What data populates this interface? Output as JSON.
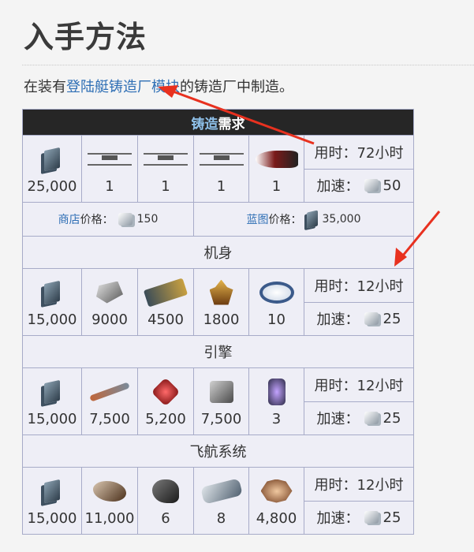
{
  "page_title": "入手方法",
  "intro": {
    "prefix": "在装有",
    "link": "登陆艇铸造厂模块",
    "suffix": "的铸造厂中制造。"
  },
  "table": {
    "header_link": "铸造",
    "header_rest": "需求",
    "time_label": "用时：",
    "rush_label": "加速：",
    "main": {
      "resources": [
        {
          "icon": "credits-icon",
          "qty": "25,000"
        },
        {
          "icon": "blueprint-part-icon",
          "qty": "1"
        },
        {
          "icon": "blueprint-part-icon",
          "qty": "1"
        },
        {
          "icon": "blueprint-part-icon",
          "qty": "1"
        },
        {
          "icon": "ship-part-icon",
          "qty": "1"
        }
      ],
      "time": "72小时",
      "rush": "50"
    },
    "market": {
      "link": "商店",
      "label": "价格：",
      "value": "150"
    },
    "blueprint": {
      "link": "蓝图",
      "label": "价格：",
      "value": "35,000"
    },
    "sections": [
      {
        "name": "机身",
        "resources": [
          {
            "icon": "credits-icon",
            "qty": "15,000"
          },
          {
            "icon": "polymer-icon",
            "qty": "9000"
          },
          {
            "icon": "plastids-icon",
            "qty": "4500"
          },
          {
            "icon": "crystal-icon",
            "qty": "1800"
          },
          {
            "icon": "alloy-ring-icon",
            "qty": "10"
          }
        ],
        "time": "12小时",
        "rush": "25"
      },
      {
        "name": "引擎",
        "resources": [
          {
            "icon": "credits-icon",
            "qty": "15,000"
          },
          {
            "icon": "rod-icon",
            "qty": "7,500"
          },
          {
            "icon": "gem-icon",
            "qty": "5,200"
          },
          {
            "icon": "block-icon",
            "qty": "7,500"
          },
          {
            "icon": "cell-icon",
            "qty": "3"
          }
        ],
        "time": "12小时",
        "rush": "25"
      },
      {
        "name": "飞航系统",
        "resources": [
          {
            "icon": "credits-icon",
            "qty": "15,000"
          },
          {
            "icon": "module-shell-icon",
            "qty": "11,000"
          },
          {
            "icon": "module-dark-icon",
            "qty": "6"
          },
          {
            "icon": "module-plate-icon",
            "qty": "8"
          },
          {
            "icon": "module-spiky-icon",
            "qty": "4,800"
          }
        ],
        "time": "12小时",
        "rush": "25"
      }
    ]
  },
  "colors": {
    "link": "#2f6fb5",
    "header_bg": "#262626",
    "arrow": "#e8311f",
    "cell_bg": "#eeeef6"
  }
}
